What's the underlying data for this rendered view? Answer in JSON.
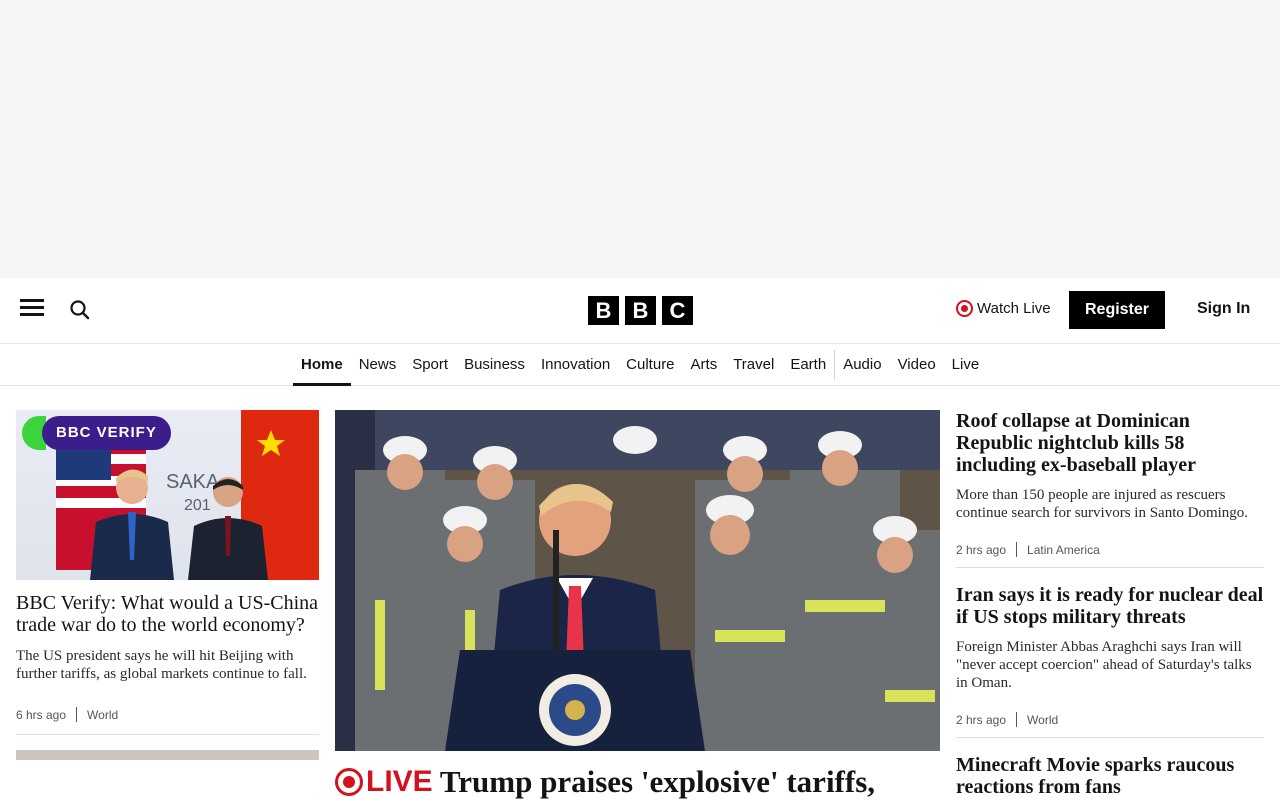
{
  "header": {
    "logo_letters": [
      "B",
      "B",
      "C"
    ],
    "watch_live_label": "Watch Live",
    "register_label": "Register",
    "sign_in_label": "Sign In",
    "live_color": "#d4111e"
  },
  "nav": {
    "items": [
      {
        "label": "Home",
        "active": true
      },
      {
        "label": "News"
      },
      {
        "label": "Sport"
      },
      {
        "label": "Business"
      },
      {
        "label": "Innovation"
      },
      {
        "label": "Culture"
      },
      {
        "label": "Arts"
      },
      {
        "label": "Travel"
      },
      {
        "label": "Earth"
      },
      {
        "label": "Audio"
      },
      {
        "label": "Video"
      },
      {
        "label": "Live"
      }
    ]
  },
  "left_story": {
    "badge": "BBC VERIFY",
    "headline": "BBC Verify: What would a US-China trade war do to the world economy?",
    "summary": "The US president says he will hit Beijing with further tariffs, as global markets continue to fall.",
    "time": "6 hrs ago",
    "section": "World"
  },
  "center_story": {
    "live_label": "LIVE",
    "headline": "Trump praises 'explosive' tariffs,"
  },
  "right_stories": [
    {
      "headline": "Roof collapse at Dominican Republic nightclub kills 58 including ex-baseball player",
      "summary": "More than 150 people are injured as rescuers continue search for survivors in Santo Domingo.",
      "time": "2 hrs ago",
      "section": "Latin America"
    },
    {
      "headline": "Iran says it is ready for nuclear deal if US stops military threats",
      "summary": "Foreign Minister Abbas Araghchi says Iran will \"never accept coercion\" ahead of Saturday's talks in Oman.",
      "time": "2 hrs ago",
      "section": "World"
    },
    {
      "headline": "Minecraft Movie sparks raucous reactions from fans"
    }
  ]
}
